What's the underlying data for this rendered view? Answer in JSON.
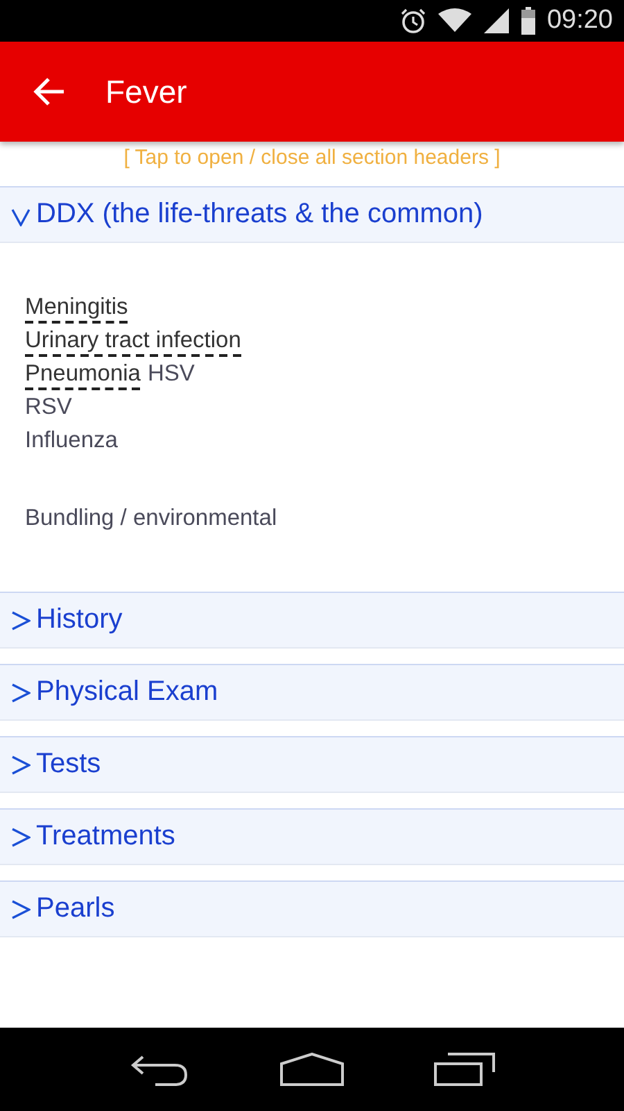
{
  "status_bar": {
    "time": "09:20"
  },
  "app_bar": {
    "title": "Fever"
  },
  "toggle_hint": "[ Tap to open / close all section headers ]",
  "sections": [
    {
      "title": "DDX (the life-threats & the common)",
      "expanded": true,
      "groups": [
        [
          [
            {
              "text": "Meningitis",
              "link": true
            }
          ],
          [
            {
              "text": "Urinary tract infection",
              "link": true
            }
          ],
          [
            {
              "text": "Pneumonia",
              "link": true
            },
            {
              "text": "HSV",
              "link": false
            }
          ],
          [
            {
              "text": "RSV",
              "link": false
            }
          ],
          [
            {
              "text": "Influenza",
              "link": false
            }
          ]
        ],
        [
          [
            {
              "text": "Bundling / environmental",
              "link": false
            }
          ]
        ]
      ]
    },
    {
      "title": "History",
      "expanded": false
    },
    {
      "title": "Physical Exam",
      "expanded": false
    },
    {
      "title": "Tests",
      "expanded": false
    },
    {
      "title": "Treatments",
      "expanded": false
    },
    {
      "title": "Pearls",
      "expanded": false
    }
  ]
}
